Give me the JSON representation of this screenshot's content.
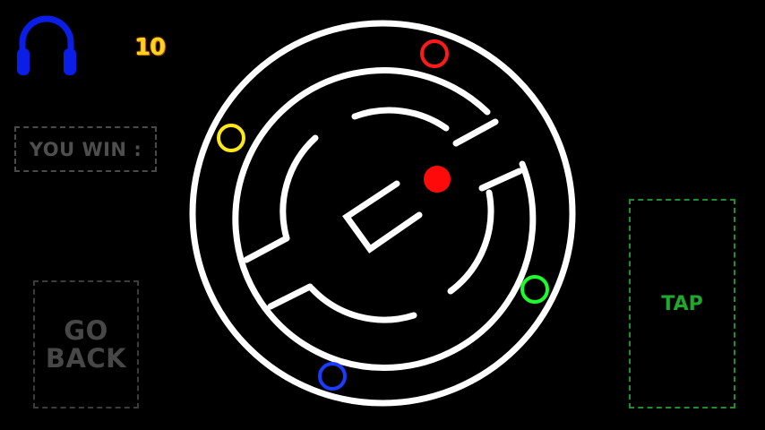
{
  "hud": {
    "score": "10",
    "audio_icon": "headphones-icon",
    "audio_color": "#0a1ee8",
    "score_color": "#ffd21f"
  },
  "status": {
    "win_label": "YOU WIN :"
  },
  "controls": {
    "go_back_line1": "GO",
    "go_back_line2": "BACK",
    "tap_label": "TAP",
    "tap_color": "#1fa82e"
  },
  "maze": {
    "wall_color": "#ffffff",
    "player_color": "#ff0a0a",
    "targets": [
      {
        "name": "red-target-ring",
        "color": "#ff1a1a"
      },
      {
        "name": "yellow-target-ring",
        "color": "#ffe81a"
      },
      {
        "name": "green-target-ring",
        "color": "#1aff2a"
      },
      {
        "name": "blue-target-ring",
        "color": "#1a3cff"
      }
    ]
  }
}
